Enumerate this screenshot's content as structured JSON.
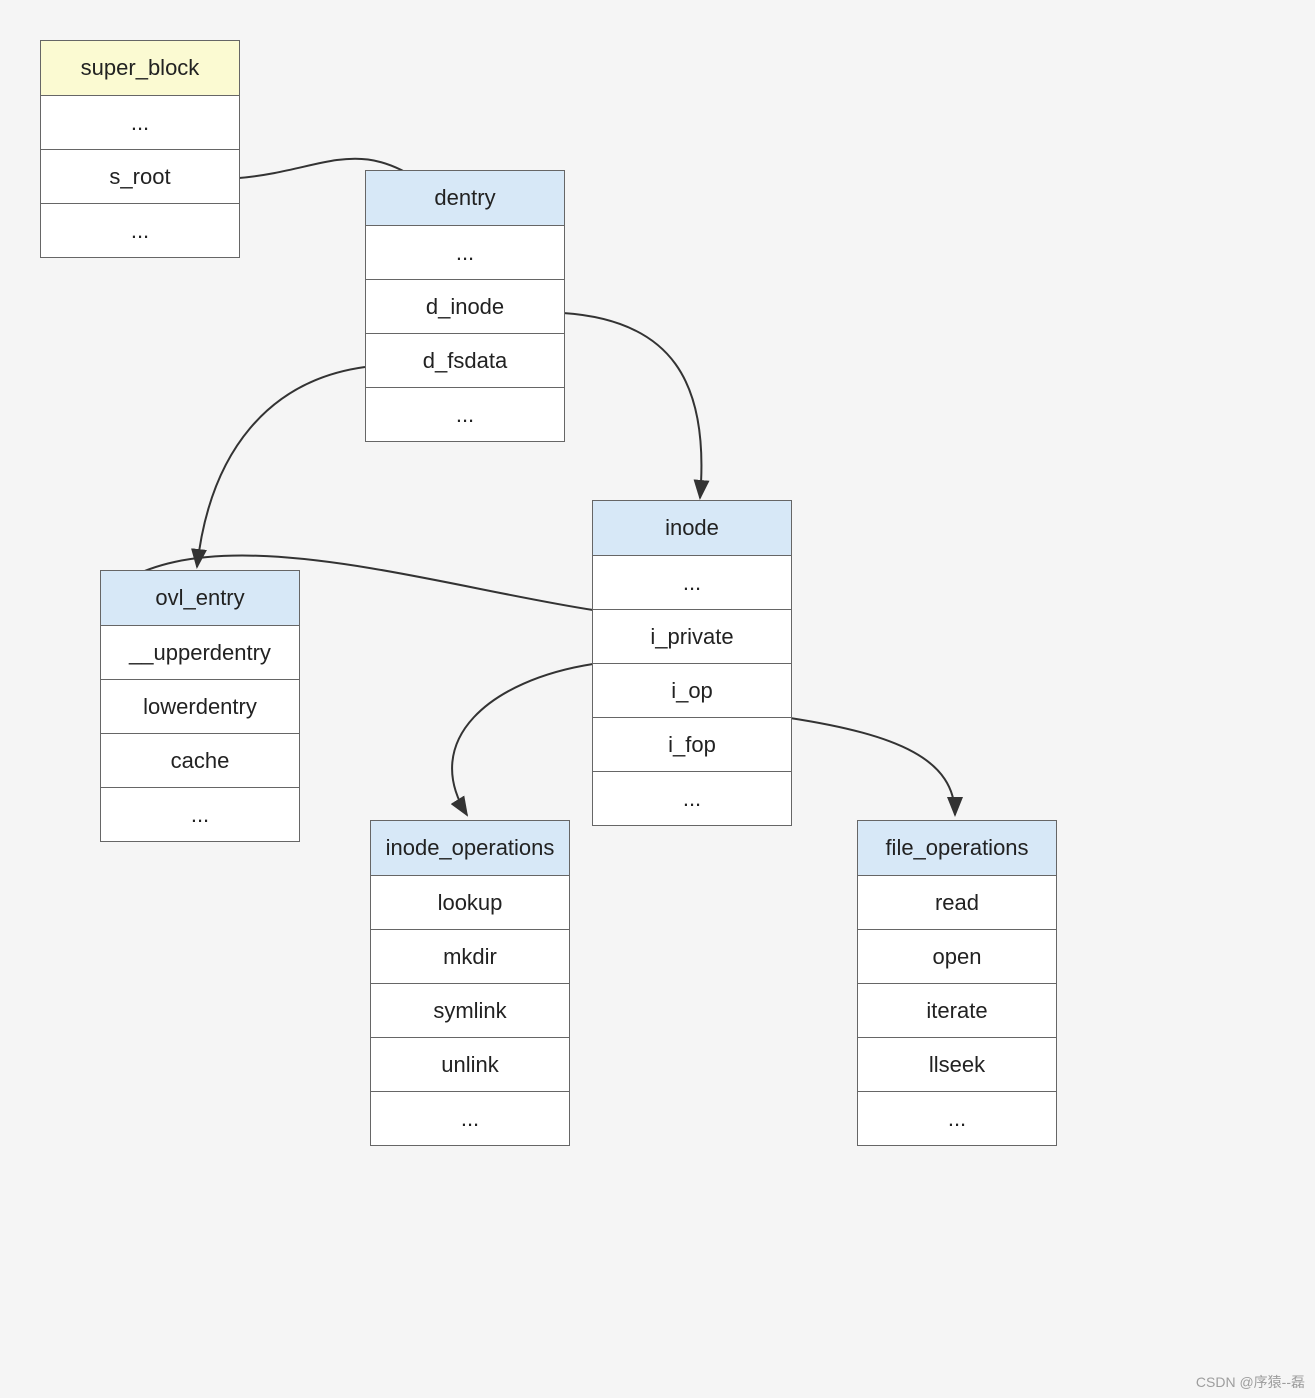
{
  "boxes": {
    "super_block": {
      "header": "super_block",
      "fields": [
        "...",
        "s_root",
        "..."
      ]
    },
    "dentry": {
      "header": "dentry",
      "fields": [
        "...",
        "d_inode",
        "d_fsdata",
        "..."
      ]
    },
    "ovl_entry": {
      "header": "ovl_entry",
      "fields": [
        "__upperdentry",
        "lowerdentry",
        "cache",
        "..."
      ]
    },
    "inode": {
      "header": "inode",
      "fields": [
        "...",
        "i_private",
        "i_op",
        "i_fop",
        "..."
      ]
    },
    "inode_operations": {
      "header": "inode_operations",
      "fields": [
        "lookup",
        "mkdir",
        "symlink",
        "unlink",
        "..."
      ]
    },
    "file_operations": {
      "header": "file_operations",
      "fields": [
        "read",
        "open",
        "iterate",
        "llseek",
        "..."
      ]
    }
  },
  "watermark": "CSDN @序猿--磊"
}
